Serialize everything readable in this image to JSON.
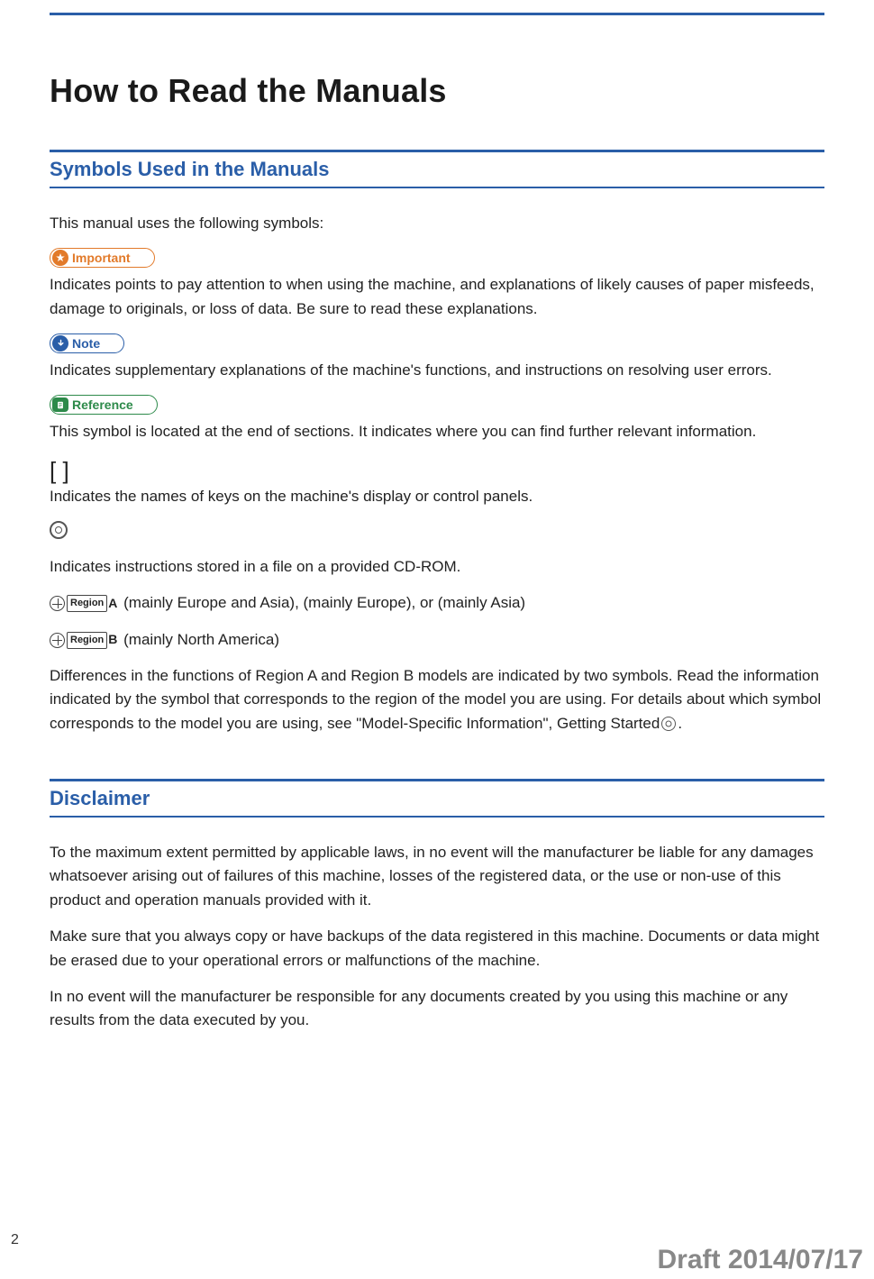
{
  "page": {
    "title": "How to Read the Manuals",
    "number": "2",
    "draft": "Draft 2014/07/17"
  },
  "sections": {
    "symbols": {
      "heading": "Symbols Used in the Manuals",
      "intro": "This manual uses the following symbols:",
      "important": {
        "label": "Important",
        "desc": "Indicates points to pay attention to when using the machine, and explanations of likely causes of paper misfeeds, damage to originals, or loss of data. Be sure to read these explanations."
      },
      "note": {
        "label": "Note",
        "desc": "Indicates supplementary explanations of the machine's functions, and instructions on resolving user errors."
      },
      "reference": {
        "label": "Reference",
        "desc": "This symbol is located at the end of sections. It indicates where you can find further relevant information."
      },
      "brackets": {
        "symbol": "[ ]",
        "desc": "Indicates the names of keys on the machine's display or control panels."
      },
      "cdrom": {
        "desc": "Indicates instructions stored in a file on a provided CD-ROM."
      },
      "regionA": {
        "tagLabel": "Region",
        "letter": "A",
        "desc": "(mainly Europe and Asia), (mainly Europe), or (mainly Asia)"
      },
      "regionB": {
        "tagLabel": "Region",
        "letter": "B",
        "desc": "(mainly North America)"
      },
      "regionSummary_a": "Differences in the functions of Region A and Region B models are indicated by two symbols. Read the information indicated by the symbol that corresponds to the region of the model you are using. For details about which symbol corresponds to the model you are using, see \"Model-Specific Information\", Getting Started",
      "regionSummary_b": "."
    },
    "disclaimer": {
      "heading": "Disclaimer",
      "p1": "To the maximum extent permitted by applicable laws, in no event will the manufacturer be liable for any damages whatsoever arising out of failures of this machine, losses of the registered data, or the use or non-use of this product and operation manuals provided with it.",
      "p2": "Make sure that you always copy or have backups of the data registered in this machine. Documents or data might be erased due to your operational errors or malfunctions of the machine.",
      "p3": "In no event will the manufacturer be responsible for any documents created by you using this machine or any results from the data executed by you."
    }
  }
}
